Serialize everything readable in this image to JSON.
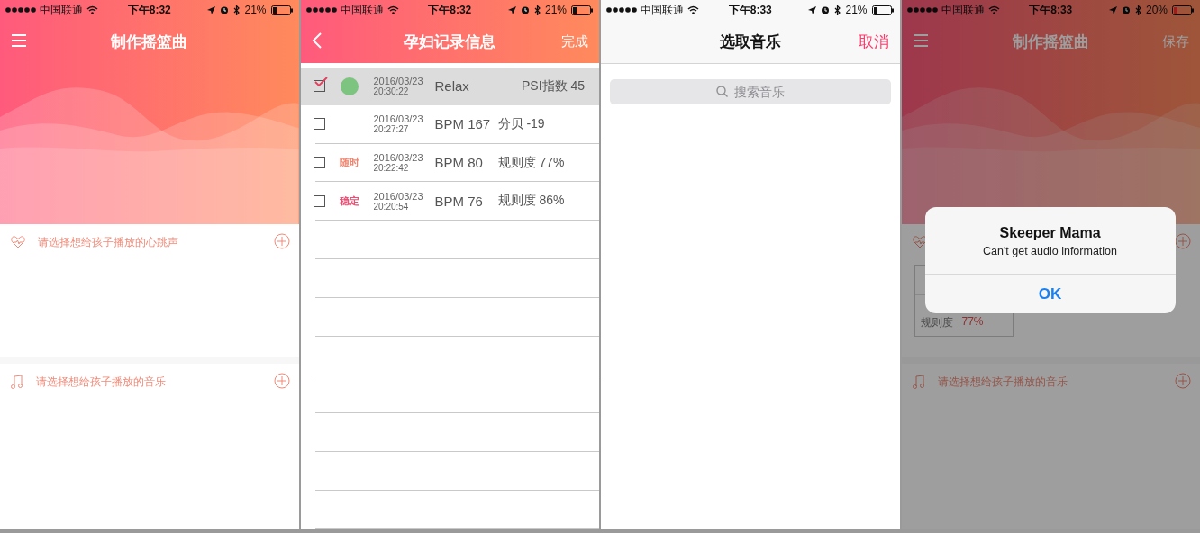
{
  "screens": [
    {
      "kind": "cradle",
      "status_bar": {
        "carrier": "中国联通",
        "time": "下午8:32",
        "battery": "21%"
      },
      "nav": {
        "title": "制作摇篮曲"
      },
      "sections": [
        {
          "kind": "heart",
          "label": "请选择想给孩子播放的心跳声"
        },
        {
          "kind": "music",
          "label": "请选择想给孩子播放的音乐"
        }
      ]
    },
    {
      "kind": "records",
      "status_bar": {
        "carrier": "中国联通",
        "time": "下午8:32",
        "battery": "21%"
      },
      "nav": {
        "title": "孕妇记录信息",
        "action": "完成"
      },
      "rows": [
        {
          "selected": true,
          "checked": true,
          "color": "#7cc47f",
          "date": "2016/03/23",
          "time": "20:30:22",
          "metric": "Relax",
          "reading": "PSI指数 45"
        },
        {
          "selected": false,
          "checked": false,
          "date": "2016/03/23",
          "time": "20:27:27",
          "metric": "BPM 167",
          "reading": "分贝 -19"
        },
        {
          "selected": false,
          "checked": false,
          "tag": "随时",
          "color": "#f2856f",
          "date": "2016/03/23",
          "time": "20:22:42",
          "metric": "BPM 80",
          "reading": "规则度 77%"
        },
        {
          "selected": false,
          "checked": false,
          "tag": "稳定",
          "color": "#ec4f74",
          "date": "2016/03/23",
          "time": "20:20:54",
          "metric": "BPM 76",
          "reading": "规则度 86%"
        }
      ]
    },
    {
      "kind": "picker",
      "status_bar": {
        "carrier": "中国联通",
        "time": "下午8:33",
        "battery": "21%"
      },
      "nav": {
        "title": "选取音乐",
        "action": "取消"
      },
      "search": {
        "placeholder": "搜索音乐"
      }
    },
    {
      "kind": "cradle",
      "status_bar": {
        "carrier": "中国联通",
        "time": "下午8:33",
        "battery": "20%",
        "battery_low": true
      },
      "nav": {
        "title": "制作摇篮曲",
        "action": "保存"
      },
      "dimmed": true,
      "sections": [
        {
          "kind": "heart",
          "card": {
            "label": "规则度",
            "value": "77%"
          }
        },
        {
          "kind": "music",
          "label": "请选择想给孩子播放的音乐"
        }
      ],
      "alert": {
        "title": "Skeeper Mama",
        "message": "Can't get audio information",
        "button": "OK"
      }
    }
  ]
}
